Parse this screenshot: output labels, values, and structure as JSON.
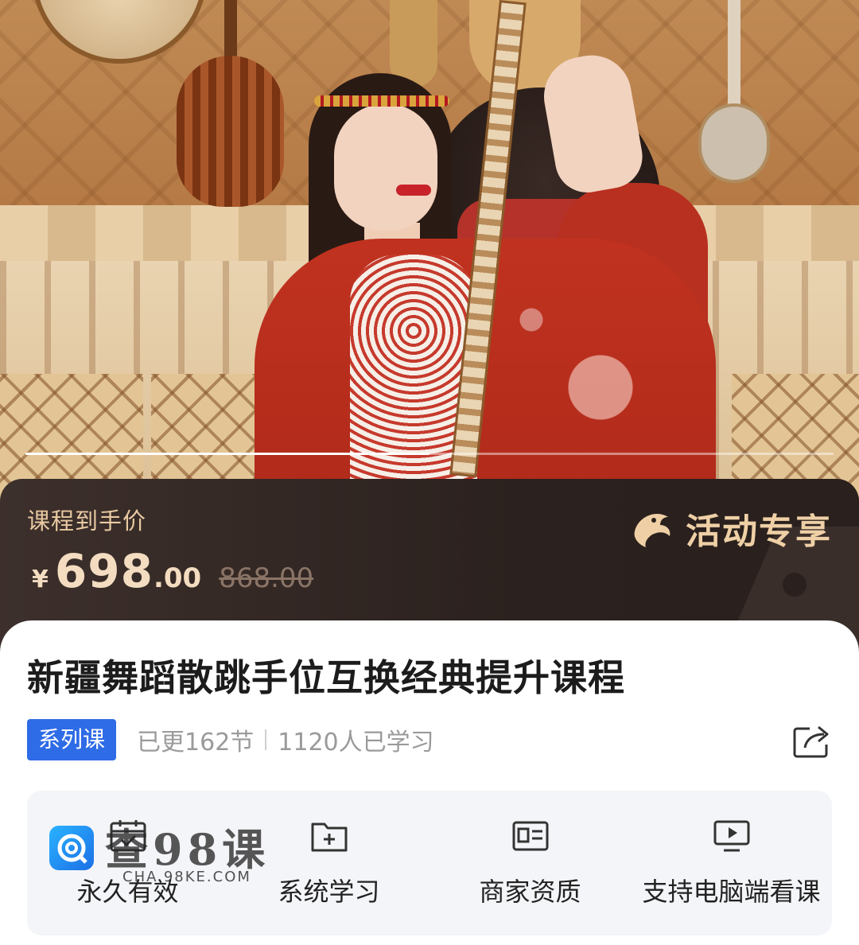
{
  "hero": {
    "carousel_progress": 0.5
  },
  "price": {
    "label": "课程到手价",
    "currency": "¥",
    "integer": "698",
    "decimal": ".00",
    "original": "868.00",
    "promo_text": "活动专享",
    "promo_icon": "dolphin-logo-icon",
    "colors": {
      "price_text": "#f3dcc0",
      "panel_bg": "#2b211e",
      "promo": "#efd0a6"
    }
  },
  "course": {
    "title": "新疆舞蹈散跳手位互换经典提升课程",
    "badge": "系列课",
    "updated": "已更162节",
    "learners": "1120人已学习",
    "share_icon": "share-icon",
    "badge_color": "#2e6be6"
  },
  "features": [
    {
      "label": "永久有效",
      "icon": "calendar-check-icon"
    },
    {
      "label": "系统学习",
      "icon": "folder-plus-icon"
    },
    {
      "label": "商家资质",
      "icon": "id-card-icon"
    },
    {
      "label": "支持电脑端看课",
      "icon": "monitor-play-icon"
    }
  ],
  "watermark": {
    "text": "查98课",
    "sub": "CHA.98KE.COM"
  }
}
